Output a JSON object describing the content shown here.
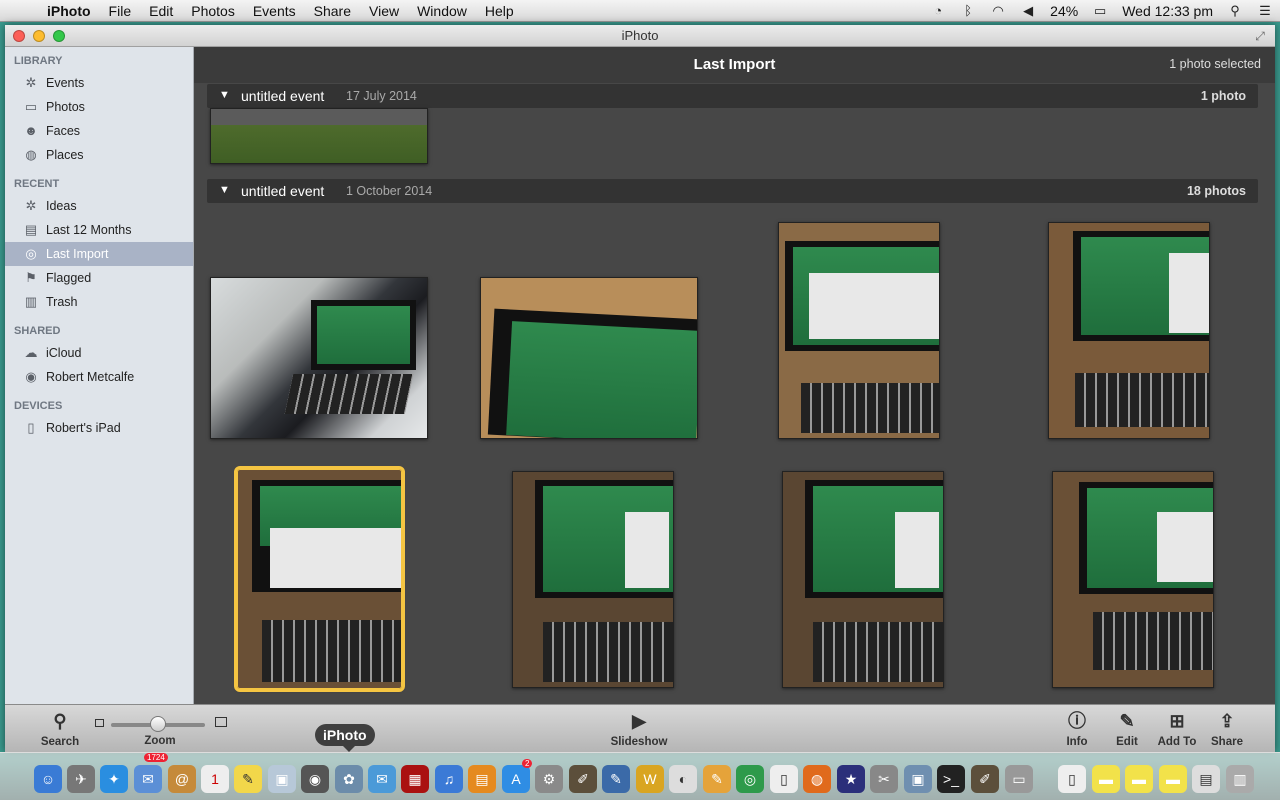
{
  "menubar": {
    "app_name": "iPhoto",
    "menus": [
      "File",
      "Edit",
      "Photos",
      "Events",
      "Share",
      "View",
      "Window",
      "Help"
    ],
    "battery": "24%",
    "clock": "Wed 12:33 pm"
  },
  "window": {
    "title": "iPhoto"
  },
  "sidebar": {
    "library_heading": "LIBRARY",
    "library": [
      {
        "label": "Events",
        "icon": "palm-tree-icon"
      },
      {
        "label": "Photos",
        "icon": "photos-icon"
      },
      {
        "label": "Faces",
        "icon": "person-icon"
      },
      {
        "label": "Places",
        "icon": "globe-icon"
      }
    ],
    "recent_heading": "RECENT",
    "recent": [
      {
        "label": "Ideas",
        "icon": "palm-tree-icon"
      },
      {
        "label": "Last 12 Months",
        "icon": "calendar-icon"
      },
      {
        "label": "Last Import",
        "icon": "import-icon",
        "selected": true
      },
      {
        "label": "Flagged",
        "icon": "flag-icon"
      },
      {
        "label": "Trash",
        "icon": "trash-icon"
      }
    ],
    "shared_heading": "SHARED",
    "shared": [
      {
        "label": "iCloud",
        "icon": "cloud-icon"
      },
      {
        "label": "Robert Metcalfe",
        "icon": "shared-stream-icon"
      }
    ],
    "devices_heading": "DEVICES",
    "devices": [
      {
        "label": "Robert's iPad",
        "icon": "ipad-icon"
      }
    ]
  },
  "main": {
    "title": "Last Import",
    "selection": "1 photo selected",
    "events": [
      {
        "name": "untitled event",
        "date": "17 July 2014",
        "count": "1 photo"
      },
      {
        "name": "untitled event",
        "date": "1 October 2014",
        "count": "18 photos"
      }
    ]
  },
  "toolbar": {
    "search": "Search",
    "zoom": "Zoom",
    "zoom_level": 0.5,
    "slideshow": "Slideshow",
    "info": "Info",
    "edit": "Edit",
    "add_to": "Add To",
    "share": "Share"
  },
  "dock": {
    "tooltip": "iPhoto",
    "mail_badge": "1724",
    "appstore_badge": "2"
  },
  "colors": {
    "selection": "#f5c542",
    "sidebar_selected": "#a9b3c6"
  }
}
